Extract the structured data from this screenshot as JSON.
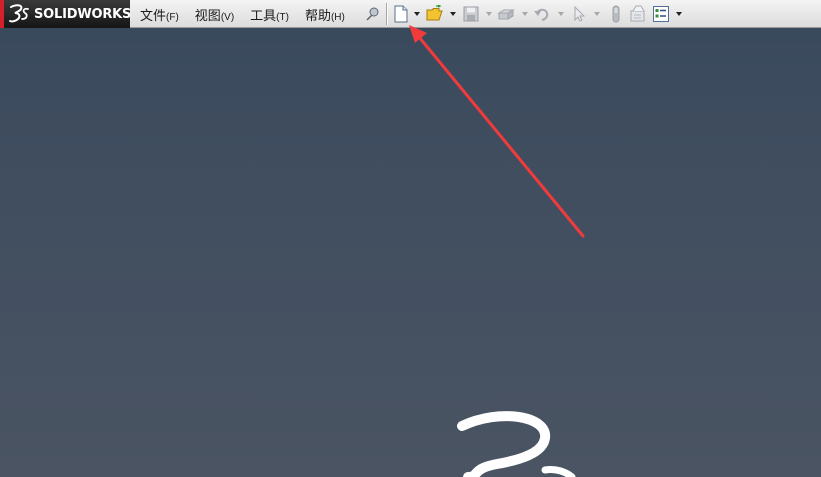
{
  "app": {
    "brand_mark": "3DS",
    "brand_name": "SOLIDWORKS"
  },
  "menu": {
    "items": [
      {
        "label": "文件",
        "accel": "(F)"
      },
      {
        "label": "视图",
        "accel": "(V)"
      },
      {
        "label": "工具",
        "accel": "(T)"
      },
      {
        "label": "帮助",
        "accel": "(H)"
      }
    ]
  },
  "toolbar": {
    "icons": [
      "pin-icon",
      "new-document-icon",
      "open-folder-icon",
      "save-icon",
      "print-icon",
      "undo-icon",
      "select-arrow-icon",
      "rebuild-icon",
      "file-properties-icon",
      "options-icon"
    ],
    "disabled": [
      "save-icon",
      "print-icon",
      "undo-icon",
      "select-arrow-icon",
      "rebuild-icon",
      "file-properties-icon"
    ]
  },
  "annotation": {
    "color": "#ef3b3b",
    "points_to": "new-document-icon"
  },
  "colors": {
    "brand_red": "#d3202a",
    "background_top": "#3a4a5d",
    "background_bottom": "#4a5463"
  }
}
